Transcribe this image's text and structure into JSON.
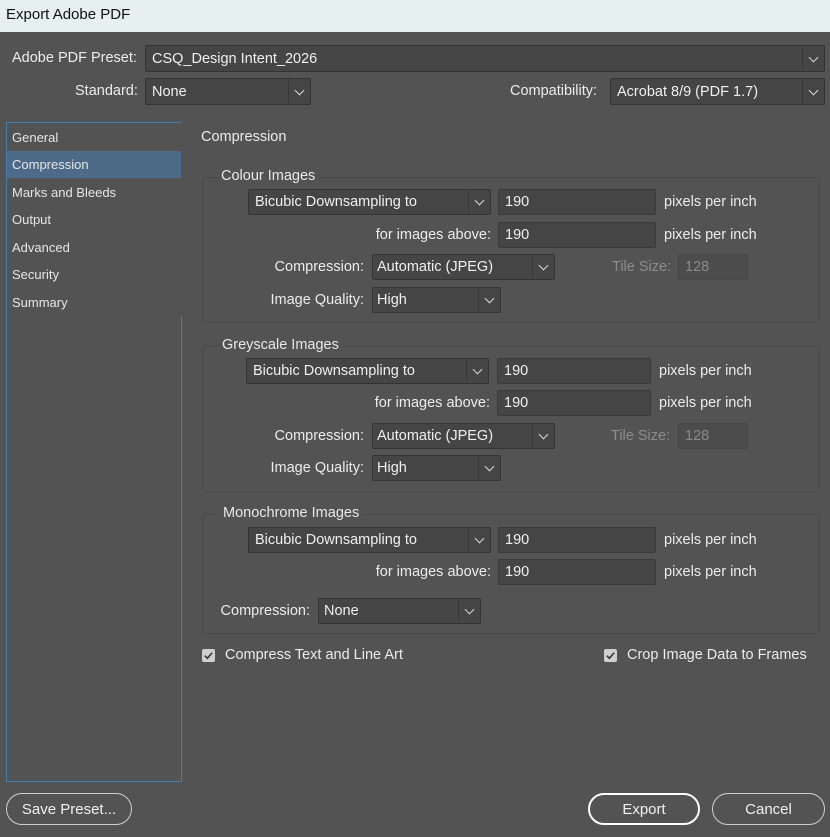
{
  "window": {
    "title": "Export Adobe PDF"
  },
  "header": {
    "preset_label": "Adobe PDF Preset:",
    "preset_value": "CSQ_Design Intent_2026",
    "standard_label": "Standard:",
    "standard_value": "None",
    "compat_label": "Compatibility:",
    "compat_value": "Acrobat 8/9 (PDF 1.7)"
  },
  "sidebar": {
    "items": [
      {
        "label": "General"
      },
      {
        "label": "Compression"
      },
      {
        "label": "Marks and Bleeds"
      },
      {
        "label": "Output"
      },
      {
        "label": "Advanced"
      },
      {
        "label": "Security"
      },
      {
        "label": "Summary"
      }
    ],
    "selected": "Compression"
  },
  "main": {
    "section_title": "Compression",
    "colour": {
      "title": "Colour Images",
      "sampling": "Bicubic Downsampling to",
      "ppi": "190",
      "ppi_unit": "pixels per inch",
      "above_label": "for images above:",
      "above": "190",
      "above_unit": "pixels per inch",
      "compression_label": "Compression:",
      "compression": "Automatic (JPEG)",
      "tile_label": "Tile Size:",
      "tile": "128",
      "quality_label": "Image Quality:",
      "quality": "High"
    },
    "grey": {
      "title": "Greyscale Images",
      "sampling": "Bicubic Downsampling to",
      "ppi": "190",
      "ppi_unit": "pixels per inch",
      "above_label": "for images above:",
      "above": "190",
      "above_unit": "pixels per inch",
      "compression_label": "Compression:",
      "compression": "Automatic (JPEG)",
      "tile_label": "Tile Size:",
      "tile": "128",
      "quality_label": "Image Quality:",
      "quality": "High"
    },
    "mono": {
      "title": "Monochrome Images",
      "sampling": "Bicubic Downsampling to",
      "ppi": "190",
      "ppi_unit": "pixels per inch",
      "above_label": "for images above:",
      "above": "190",
      "above_unit": "pixels per inch",
      "compression_label": "Compression:",
      "compression": "None"
    },
    "compress_text_label": "Compress Text and Line Art",
    "compress_text_checked": true,
    "crop_label": "Crop Image Data to Frames",
    "crop_checked": true
  },
  "footer": {
    "save_preset": "Save Preset...",
    "export": "Export",
    "cancel": "Cancel"
  },
  "colors": {
    "selection": "#4d6b88",
    "panel": "#535353",
    "focus_border": "#3f7fb8"
  },
  "icons": {
    "dropdown": "chevron-down-icon",
    "checkbox": "checkmark-icon"
  }
}
